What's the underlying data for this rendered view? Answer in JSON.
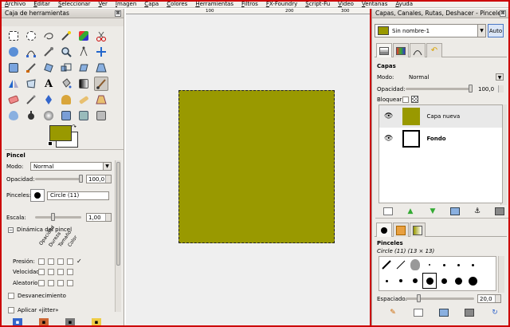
{
  "menu": [
    "Archivo",
    "Editar",
    "Seleccionar",
    "Ver",
    "Imagen",
    "Capa",
    "Colores",
    "Herramientas",
    "Filtros",
    "FX-Foundry",
    "Script-Fu",
    "Vídeo",
    "Ventanas",
    "Ayuda"
  ],
  "toolbox": {
    "title": "Caja de herramientas",
    "close_icon": "⊠"
  },
  "ruler": [
    "100",
    "200",
    "300"
  ],
  "tool_options": {
    "title": "Pincel",
    "mode_label": "Modo:",
    "mode_value": "Normal",
    "opacity_label": "Opacidad:",
    "opacity_value": "100,0",
    "opacity_fraction": 1.0,
    "brush_label": "Pinceles:",
    "brush_value": "Circle (11)",
    "scale_label": "Escala:",
    "scale_value": "1,00",
    "scale_fraction": 0.4,
    "dynamics_label": "Dinámica del pincel",
    "dyn_columns": [
      "Opacidad",
      "Dureza",
      "Tamaño",
      "Color"
    ],
    "dyn_rows": [
      {
        "label": "Presión:",
        "checks": [
          false,
          false,
          false,
          false
        ],
        "mark": "✓"
      },
      {
        "label": "Velocidad:",
        "checks": [
          false,
          false,
          false,
          false
        ],
        "mark": ""
      },
      {
        "label": "Aleatorio:",
        "checks": [
          false,
          false,
          false,
          false
        ],
        "mark": ""
      }
    ],
    "fade_label": "Desvanecimiento",
    "jitter_label": "Aplicar «jitter»"
  },
  "dock": {
    "title": "Capas, Canales, Rutas, Deshacer - Pinceles, ...",
    "image_select": "Sin nombre-1",
    "auto_label": "Auto",
    "layers_title": "Capas",
    "mode_label": "Modo:",
    "mode_value": "Normal",
    "opacity_label": "Opacidad:",
    "opacity_value": "100,0",
    "opacity_fraction": 1.0,
    "lock_label": "Bloquear:",
    "layers": [
      {
        "name": "Capa nueva",
        "color": "#999900",
        "selected": true
      },
      {
        "name": "Fondo",
        "color": "#ffffff",
        "selected": false
      }
    ],
    "brushes_title": "Pinceles",
    "brush_info": "Circle (11) (13 × 13)",
    "spacing_label": "Espaciado:",
    "spacing_value": "20,0",
    "spacing_fraction": 0.2
  },
  "colors": {
    "foreground": "#999900",
    "background": "#ffffff",
    "canvas": "#999900"
  }
}
